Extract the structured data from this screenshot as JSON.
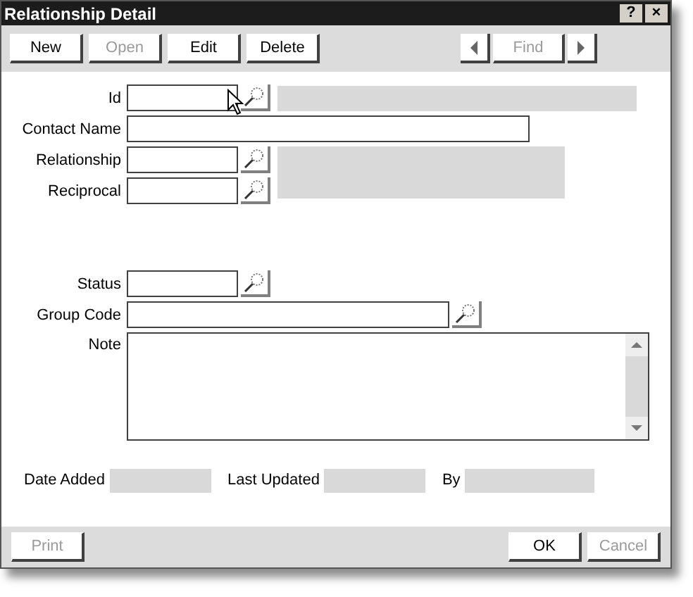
{
  "window": {
    "title": "Relationship Detail",
    "title_buttons": [
      "?",
      "×"
    ]
  },
  "toolbar": [
    {
      "label": "New",
      "disabled": false
    },
    {
      "label": "Open",
      "disabled": true
    },
    {
      "label": "Edit",
      "disabled": false
    },
    {
      "label": "Delete",
      "disabled": false
    }
  ],
  "navigator": {
    "previous_disabled": false,
    "find": {
      "label": "Find",
      "disabled": true
    },
    "next_disabled": false
  },
  "form": {
    "id": {
      "label": "Id"
    },
    "contact_name": {
      "label": "Contact Name"
    },
    "relationship": {
      "label": "Relationship"
    },
    "reciprocal": {
      "label": "Reciprocal"
    },
    "status": {
      "label": "Status"
    },
    "group_code": {
      "label": "Group Code"
    },
    "note": {
      "label": "Note"
    }
  },
  "audit": [
    {
      "label": "Date Added"
    },
    {
      "label": "Last Updated"
    },
    {
      "label": "By"
    }
  ],
  "footer": {
    "left": [
      {
        "label": "Print",
        "disabled": true
      }
    ],
    "right": [
      {
        "label": "OK",
        "disabled": false
      },
      {
        "label": "Cancel",
        "disabled": true
      }
    ]
  }
}
